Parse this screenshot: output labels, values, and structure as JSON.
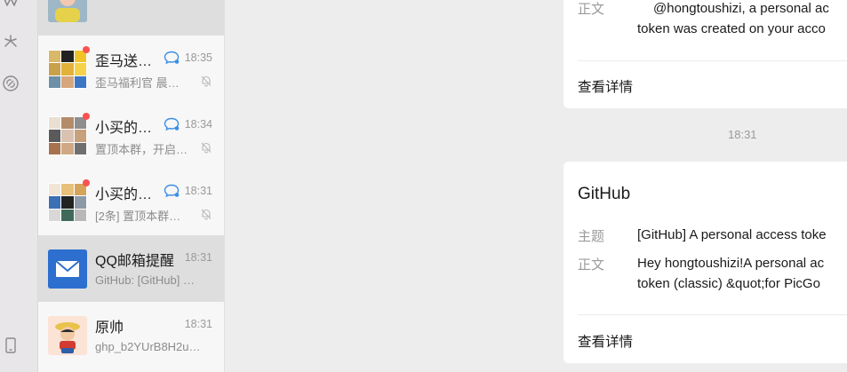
{
  "rail": {
    "icons": [
      "wechat-w-icon",
      "sparkle-icon",
      "link-icon",
      "phone-icon"
    ]
  },
  "chat_list": [
    {
      "title": "",
      "time": "",
      "sub": "",
      "avatar": "person-photo",
      "active": true
    },
    {
      "title": "歪马送…",
      "time": "18:35",
      "sub": "歪马福利官 晨…",
      "unread_dot": true,
      "chat_icon": true,
      "muted": true
    },
    {
      "title": "小买的…",
      "time": "18:34",
      "sub": "置顶本群，开启…",
      "unread_dot": true,
      "chat_icon": true,
      "muted": true
    },
    {
      "title": "小买的…",
      "time": "18:31",
      "sub": "[2条] 置顶本群…",
      "unread_dot": true,
      "chat_icon": true,
      "muted": true
    },
    {
      "title": "QQ邮箱提醒",
      "time": "18:31",
      "sub": "GitHub: [GitHub] …",
      "avatar": "mail-icon",
      "active": true
    },
    {
      "title": "原帅",
      "time": "18:31",
      "sub": "ghp_b2YUrB8H2u…",
      "avatar": "cartoon-avatar"
    }
  ],
  "messages": {
    "card1": {
      "body_label": "正文",
      "body_line1": "@hongtoushizi, a personal ac",
      "body_line2": "token was created on your acco",
      "more": "查看详情"
    },
    "timestamp": "18:31",
    "card2": {
      "title": "GitHub",
      "subject_label": "主题",
      "subject": "[GitHub] A personal access toke",
      "body_label": "正文",
      "body_line1": "Hey hongtoushizi!A personal ac",
      "body_line2": "token (classic) &quot;for PicGo",
      "more": "查看详情"
    }
  },
  "colors": {
    "accent_mail": "#2d6fcf",
    "unread_dot": "#fa5151",
    "chat_bubble": "#3a8ee6"
  }
}
